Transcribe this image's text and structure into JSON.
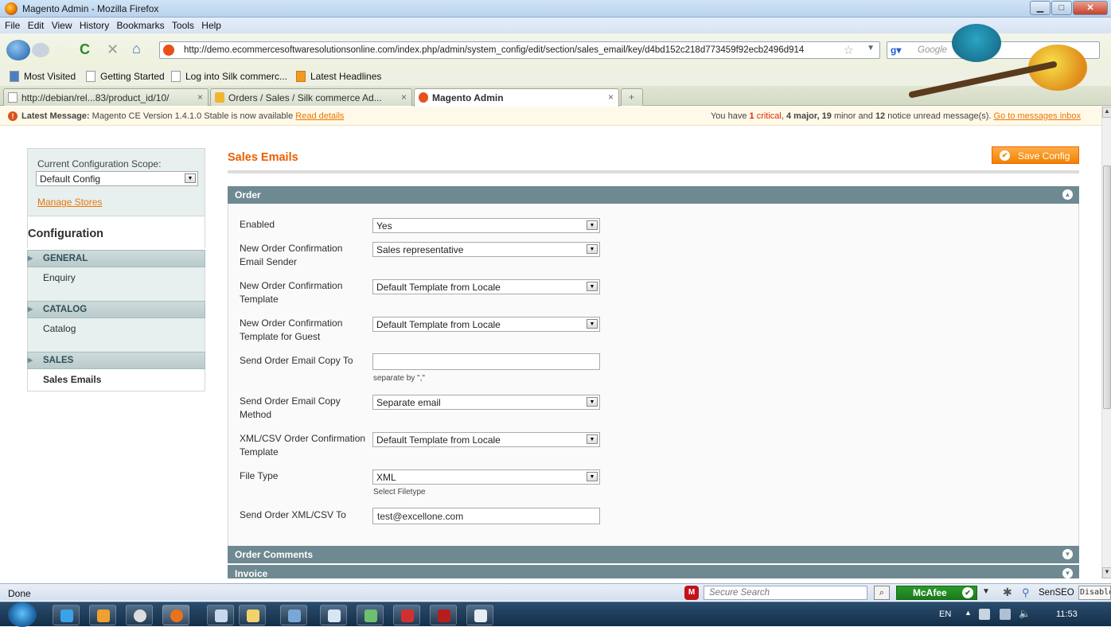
{
  "browser": {
    "title": "Magento Admin - Mozilla Firefox",
    "menu": [
      "File",
      "Edit",
      "View",
      "History",
      "Bookmarks",
      "Tools",
      "Help"
    ],
    "url": "http://demo.ecommercesoftwaresolutionsonline.com/index.php/admin/system_config/edit/section/sales_email/key/d4bd152c218d773459f92ecb2496d914",
    "search_placeholder": "Google",
    "bookmarks": [
      "Most Visited",
      "Getting Started",
      "Log into Silk commerc...",
      "Latest Headlines"
    ],
    "tabs": [
      {
        "label": "http://debian/rel...83/product_id/10/",
        "active": false
      },
      {
        "label": "Orders / Sales / Silk commerce Ad...",
        "active": false
      },
      {
        "label": "Magento Admin",
        "active": true
      }
    ],
    "status": "Done",
    "status_search_placeholder": "Secure Search",
    "mcafee": "McAfee",
    "senseo": "SenSEO",
    "disabled": "Disabled"
  },
  "messages": {
    "latest_label": "Latest Message:",
    "latest_text": "Magento CE Version 1.4.1.0 Stable is now available",
    "read_details": "Read details",
    "summary_prefix": "You have",
    "critical_count": "1",
    "critical_label": "critical",
    "major": "4 major,",
    "minor_count": "19",
    "minor_label": "minor and",
    "notice_count": "12",
    "notice_label": "notice unread message(s).",
    "inbox_link": "Go to messages inbox"
  },
  "sidebar": {
    "scope_label": "Current Configuration Scope:",
    "scope_value": "Default Config",
    "manage_stores": "Manage Stores",
    "config_title": "Configuration",
    "sections": [
      {
        "header": "GENERAL",
        "item": "Enquiry"
      },
      {
        "header": "CATALOG",
        "item": "Catalog"
      },
      {
        "header": "SALES",
        "item": "Sales Emails"
      }
    ]
  },
  "main": {
    "title": "Sales Emails",
    "save_label": "Save Config",
    "order_header": "Order",
    "fields": {
      "enabled": {
        "label": "Enabled",
        "value": "Yes"
      },
      "sender": {
        "label": "New Order Confirmation Email Sender",
        "value": "Sales representative"
      },
      "template": {
        "label": "New Order Confirmation Template",
        "value": "Default Template from Locale"
      },
      "guest_template": {
        "label": "New Order Confirmation Template for Guest",
        "value": "Default Template from Locale"
      },
      "copy_to": {
        "label": "Send Order Email Copy To",
        "value": "",
        "note": "separate by \",\""
      },
      "copy_method": {
        "label": "Send Order Email Copy Method",
        "value": "Separate email"
      },
      "xml_template": {
        "label": "XML/CSV Order Confirmation Template",
        "value": "Default Template from Locale"
      },
      "file_type": {
        "label": "File Type",
        "value": "XML",
        "note": "Select Filetype"
      },
      "send_xml_to": {
        "label": "Send Order XML/CSV To",
        "value": "test@excellone.com"
      }
    },
    "collapsed_sections": [
      "Order Comments",
      "Invoice"
    ]
  },
  "taskbar": {
    "lang": "EN",
    "clock": "11:53"
  },
  "colors": {
    "accent": "#eb5e00",
    "section_header": "#6f8992",
    "link": "#ea7601"
  }
}
